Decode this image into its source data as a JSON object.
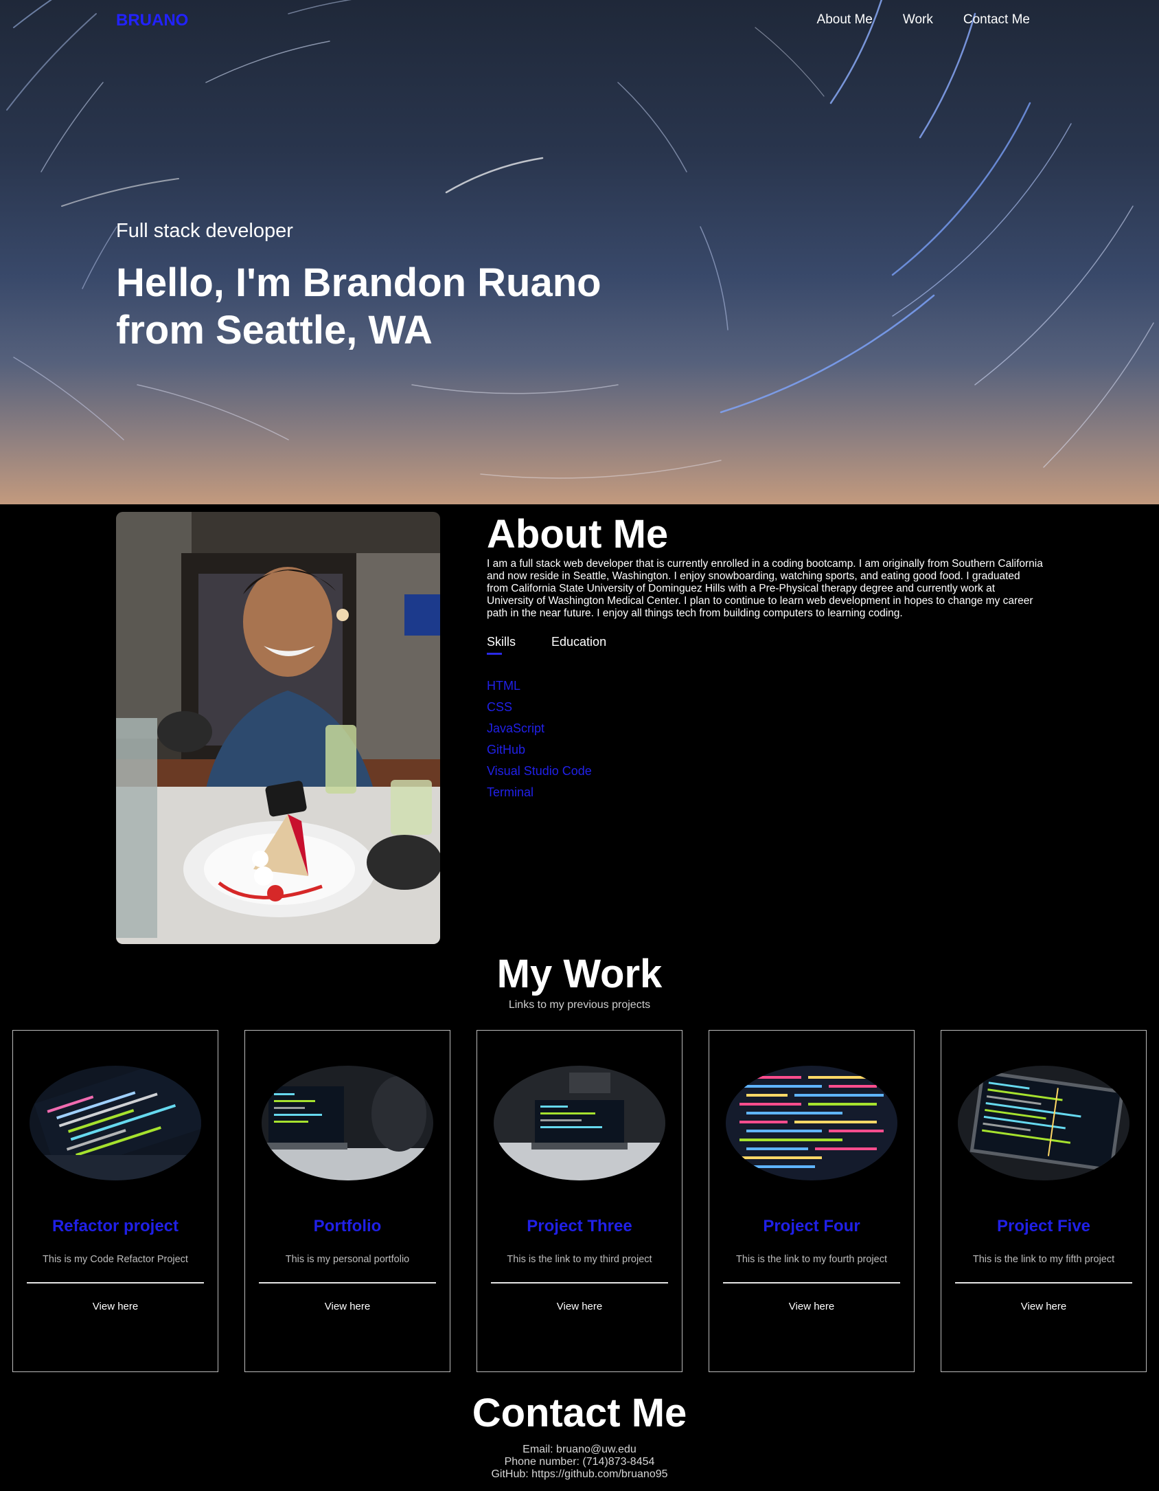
{
  "header": {
    "brand": "BRUANO",
    "nav": [
      {
        "label": "About Me"
      },
      {
        "label": "Work"
      },
      {
        "label": "Contact Me"
      }
    ]
  },
  "hero": {
    "subtitle": "Full stack developer",
    "title": "Hello, I'm Brandon Ruano from Seattle, WA"
  },
  "about": {
    "heading": "About Me",
    "body": "I am a full stack web developer that is currently enrolled in a coding bootcamp. I am originally from Southern California and now reside in Seattle, Washington. I enjoy snowboarding, watching sports, and eating good food. I graduated from California State University of Dominguez Hills with a Pre-Physical therapy degree and currently work at University of Washington Medical Center. I plan to continue to learn web development in hopes to change my career path in the near future. I enjoy all things tech from building computers to learning coding.",
    "tabs": [
      {
        "label": "Skills"
      },
      {
        "label": "Education"
      }
    ],
    "skills": [
      "HTML",
      "CSS",
      "JavaScript",
      "GitHub",
      "Visual Studio Code",
      "Terminal"
    ]
  },
  "work": {
    "heading": "My Work",
    "subtitle": "Links to my previous projects",
    "projects": [
      {
        "title": "Refactor project",
        "description": "This is my Code Refactor Project",
        "link": "View here"
      },
      {
        "title": "Portfolio",
        "description": "This is my personal portfolio",
        "link": "View here"
      },
      {
        "title": "Project Three",
        "description": "This is the link to my third project",
        "link": "View here"
      },
      {
        "title": "Project Four",
        "description": "This is the link to my fourth project",
        "link": "View here"
      },
      {
        "title": "Project Five",
        "description": "This is the link to my fifth project",
        "link": "View here"
      }
    ]
  },
  "contact": {
    "heading": "Contact Me",
    "email": "Email: bruano@uw.edu",
    "phone": "Phone number: (714)873-8454",
    "github": "GitHub: https://github.com/bruano95"
  },
  "colors": {
    "accent": "#2020e6",
    "background": "#000000"
  }
}
